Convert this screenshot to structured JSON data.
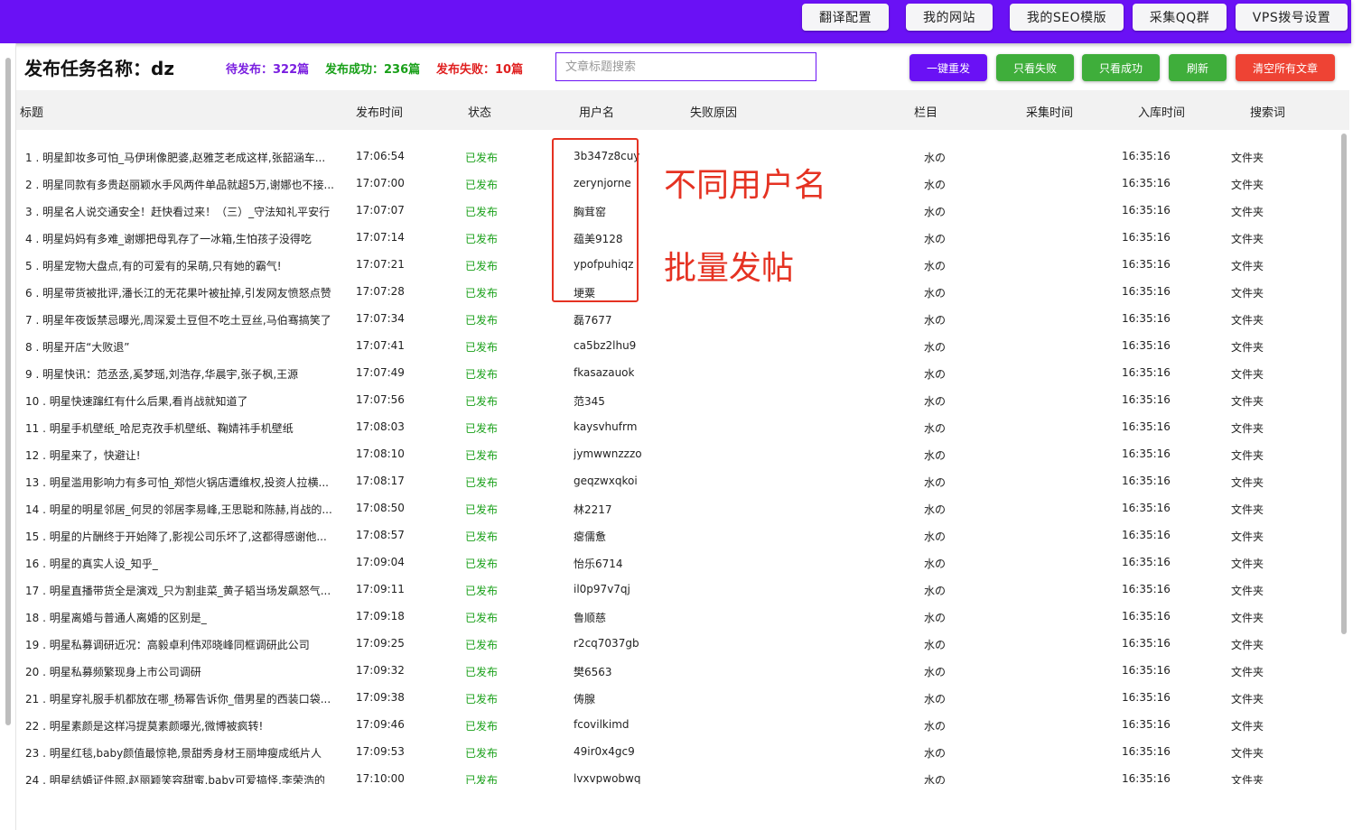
{
  "nav": {
    "buttons": [
      {
        "label": "翻译配置"
      },
      {
        "label": "我的网站"
      },
      {
        "label": "我的SEO模版"
      },
      {
        "label": "采集QQ群"
      },
      {
        "label": "VPS拨号设置"
      }
    ]
  },
  "header": {
    "title": "发布任务名称：dz",
    "pending": "待发布：322篇",
    "success": "发布成功：236篇",
    "failed": "发布失败：10篇",
    "search_placeholder": "文章标题搜索",
    "actions": [
      {
        "label": "一键重发",
        "color": "#6a11f5"
      },
      {
        "label": "只看失败",
        "color": "#3fae3b"
      },
      {
        "label": "只看成功",
        "color": "#3fae3b"
      },
      {
        "label": "刷新",
        "color": "#3fae3b"
      },
      {
        "label": "清空所有文章",
        "color": "#ee4334"
      }
    ]
  },
  "colors": {
    "accent": "#6a11f5",
    "pending": "#7a1fe0",
    "success": "#19a019",
    "failed": "#e02020",
    "annotation": "#e53222"
  },
  "table": {
    "columns": [
      "标题",
      "发布时间",
      "状态",
      "用户名",
      "失败原因",
      "栏目",
      "采集时间",
      "入库时间",
      "搜索词"
    ],
    "rows": [
      {
        "title": "1 . 明星卸妆多可怕_马伊琍像肥婆,赵雅芝老成这样,张韶涵车...",
        "time": "17:06:54",
        "status": "已发布",
        "user": "3b347z8cuy",
        "column": "水の",
        "captured": "16:35:16",
        "keyword": "文件夹"
      },
      {
        "title": "2 . 明星同款有多贵赵丽颖水手风两件单品就超5万,谢娜也不接...",
        "time": "17:07:00",
        "status": "已发布",
        "user": "zerynjorne",
        "column": "水の",
        "captured": "16:35:16",
        "keyword": "文件夹"
      },
      {
        "title": "3 . 明星名人说交通安全！赶快看过来！（三）_守法知礼平安行",
        "time": "17:07:07",
        "status": "已发布",
        "user": "胸茸窑",
        "column": "水の",
        "captured": "16:35:16",
        "keyword": "文件夹"
      },
      {
        "title": "4 . 明星妈妈有多难_谢娜把母乳存了一冰箱,生怕孩子没得吃",
        "time": "17:07:14",
        "status": "已发布",
        "user": "蕴美9128",
        "column": "水の",
        "captured": "16:35:16",
        "keyword": "文件夹"
      },
      {
        "title": "5 . 明星宠物大盘点,有的可爱有的呆萌,只有她的霸气!",
        "time": "17:07:21",
        "status": "已发布",
        "user": "ypofpuhiqz",
        "column": "水の",
        "captured": "16:35:16",
        "keyword": "文件夹"
      },
      {
        "title": "6 . 明星带货被批评,潘长江的无花果叶被扯掉,引发网友愤怒点赞",
        "time": "17:07:28",
        "status": "已发布",
        "user": "埂粟",
        "column": "水の",
        "captured": "16:35:16",
        "keyword": "文件夹"
      },
      {
        "title": "7 . 明星年夜饭禁忌曝光,周深爱土豆但不吃土豆丝,马伯骞搞笑了",
        "time": "17:07:34",
        "status": "已发布",
        "user": "磊7677",
        "column": "水の",
        "captured": "16:35:16",
        "keyword": "文件夹"
      },
      {
        "title": "8 . 明星开店“大败退”",
        "time": "17:07:41",
        "status": "已发布",
        "user": "ca5bz2lhu9",
        "column": "水の",
        "captured": "16:35:16",
        "keyword": "文件夹"
      },
      {
        "title": "9 . 明星快讯：范丞丞,奚梦瑶,刘浩存,华晨宇,张子枫,王源",
        "time": "17:07:49",
        "status": "已发布",
        "user": "fkasazauok",
        "column": "水の",
        "captured": "16:35:16",
        "keyword": "文件夹"
      },
      {
        "title": "10 . 明星快速蹿红有什么后果,看肖战就知道了",
        "time": "17:07:56",
        "status": "已发布",
        "user": "范345",
        "column": "水の",
        "captured": "16:35:16",
        "keyword": "文件夹"
      },
      {
        "title": "11 . 明星手机壁纸_哈尼克孜手机壁纸、鞠婧祎手机壁纸",
        "time": "17:08:03",
        "status": "已发布",
        "user": "kaysvhufrm",
        "column": "水の",
        "captured": "16:35:16",
        "keyword": "文件夹"
      },
      {
        "title": "12 . 明星来了，快避让!",
        "time": "17:08:10",
        "status": "已发布",
        "user": "jymwwnzzzo",
        "column": "水の",
        "captured": "16:35:16",
        "keyword": "文件夹"
      },
      {
        "title": "13 . 明星滥用影响力有多可怕_郑恺火锅店遭维权,投资人拉横...",
        "time": "17:08:17",
        "status": "已发布",
        "user": "geqzwxqkoi",
        "column": "水の",
        "captured": "16:35:16",
        "keyword": "文件夹"
      },
      {
        "title": "14 . 明星的明星邻居_何炅的邻居李易峰,王思聪和陈赫,肖战的...",
        "time": "17:08:50",
        "status": "已发布",
        "user": "林2217",
        "column": "水の",
        "captured": "16:35:16",
        "keyword": "文件夹"
      },
      {
        "title": "15 . 明星的片酬终于开始降了,影视公司乐坏了,这都得感谢他...",
        "time": "17:08:57",
        "status": "已发布",
        "user": "瘪儒惫",
        "column": "水の",
        "captured": "16:35:16",
        "keyword": "文件夹"
      },
      {
        "title": "16 . 明星的真实人设_知乎_",
        "time": "17:09:04",
        "status": "已发布",
        "user": "怡乐6714",
        "column": "水の",
        "captured": "16:35:16",
        "keyword": "文件夹"
      },
      {
        "title": "17 . 明星直播带货全是演戏_只为割韭菜_黄子韬当场发飙怒气...",
        "time": "17:09:11",
        "status": "已发布",
        "user": "il0p97v7qj",
        "column": "水の",
        "captured": "16:35:16",
        "keyword": "文件夹"
      },
      {
        "title": "18 . 明星离婚与普通人离婚的区别是_",
        "time": "17:09:18",
        "status": "已发布",
        "user": "鲁顺慈",
        "column": "水の",
        "captured": "16:35:16",
        "keyword": "文件夹"
      },
      {
        "title": "19 . 明星私募调研近况：高毅卓利伟邓晓峰同框调研此公司",
        "time": "17:09:25",
        "status": "已发布",
        "user": "r2cq7037gb",
        "column": "水の",
        "captured": "16:35:16",
        "keyword": "文件夹"
      },
      {
        "title": "20 . 明星私募频繁现身上市公司调研",
        "time": "17:09:32",
        "status": "已发布",
        "user": "樊6563",
        "column": "水の",
        "captured": "16:35:16",
        "keyword": "文件夹"
      },
      {
        "title": "21 . 明星穿礼服手机都放在哪_杨幂告诉你_借男星的西装口袋...",
        "time": "17:09:38",
        "status": "已发布",
        "user": "俦腺",
        "column": "水の",
        "captured": "16:35:16",
        "keyword": "文件夹"
      },
      {
        "title": "22 . 明星素颜是这样冯提莫素颜曝光,微博被疯转!",
        "time": "17:09:46",
        "status": "已发布",
        "user": "fcovilkimd",
        "column": "水の",
        "captured": "16:35:16",
        "keyword": "文件夹"
      },
      {
        "title": "23 . 明星红毯,baby颜值最惊艳,景甜秀身材王丽坤瘦成纸片人",
        "time": "17:09:53",
        "status": "已发布",
        "user": "49ir0x4gc9",
        "column": "水の",
        "captured": "16:35:16",
        "keyword": "文件夹"
      },
      {
        "title": "24 . 明星结婚证件照,赵丽颖笑容甜蜜,baby可爱搞怪,李荣浩的",
        "time": "17:10:00",
        "status": "已发布",
        "user": "lvxvpwobwq",
        "column": "水の",
        "captured": "16:35:16",
        "keyword": "文件夹"
      }
    ]
  },
  "annotations": {
    "text1": "不同用户名",
    "text2": "批量发帖"
  }
}
